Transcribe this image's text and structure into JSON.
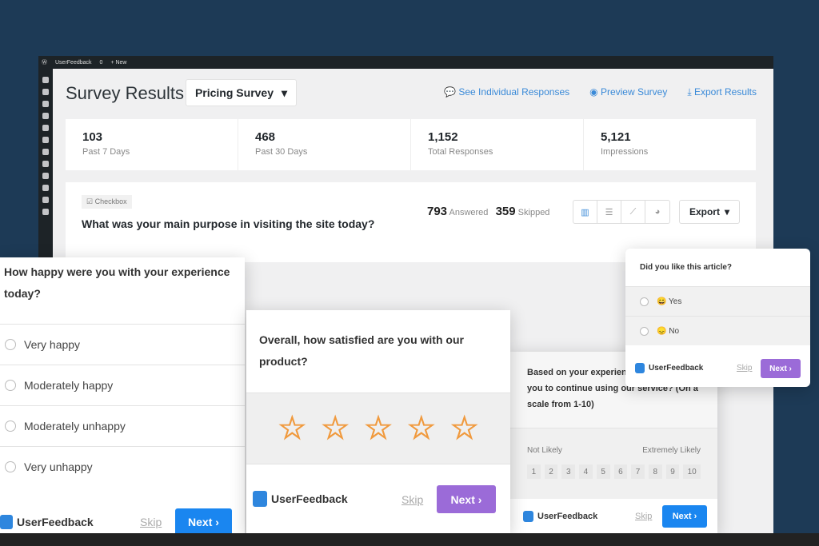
{
  "topbar": {
    "site": "UserFeedback",
    "comments": "0",
    "new": "+ New"
  },
  "header": {
    "title": "Survey Results",
    "survey_select": "Pricing Survey",
    "links": [
      "See Individual Responses",
      "Preview Survey",
      "Export Results"
    ]
  },
  "stats": [
    {
      "value": "103",
      "label": "Past 7 Days"
    },
    {
      "value": "468",
      "label": "Past 30 Days"
    },
    {
      "value": "1,152",
      "label": "Total Responses"
    },
    {
      "value": "5,121",
      "label": "Impressions"
    }
  ],
  "question": {
    "type": "Checkbox",
    "text": "What was your main purpose in visiting the site today?",
    "answered": "793",
    "answered_label": "Answered",
    "skipped": "359",
    "skipped_label": "Skipped",
    "export": "Export"
  },
  "survey_happy": {
    "question": "How happy were you with your experience today?",
    "options": [
      "Very happy",
      "Moderately happy",
      "Moderately unhappy",
      "Very unhappy"
    ],
    "brand": "UserFeedback",
    "skip": "Skip",
    "next": "Next"
  },
  "survey_stars": {
    "question": "Overall, how satisfied are you with our product?",
    "rating_max": 5,
    "brand": "UserFeedback",
    "skip": "Skip",
    "next": "Next"
  },
  "survey_nps": {
    "question": "Based on your experience, how likely are you to continue using our service? (On a scale from 1-10)",
    "low": "Not Likely",
    "high": "Extremely Likely",
    "scale": [
      "1",
      "2",
      "3",
      "4",
      "5",
      "6",
      "7",
      "8",
      "9",
      "10"
    ],
    "brand": "UserFeedback",
    "skip": "Skip",
    "next": "Next"
  },
  "survey_article": {
    "question": "Did you like this article?",
    "options": [
      "😄 Yes",
      "😞 No"
    ],
    "brand": "UserFeedback",
    "skip": "Skip",
    "next": "Next"
  },
  "colors": {
    "background": "#1d3a56",
    "link": "#3a8ad8",
    "next_blue": "#1a86f0",
    "next_purple": "#9b6bd8",
    "star": "#f09a3e"
  }
}
